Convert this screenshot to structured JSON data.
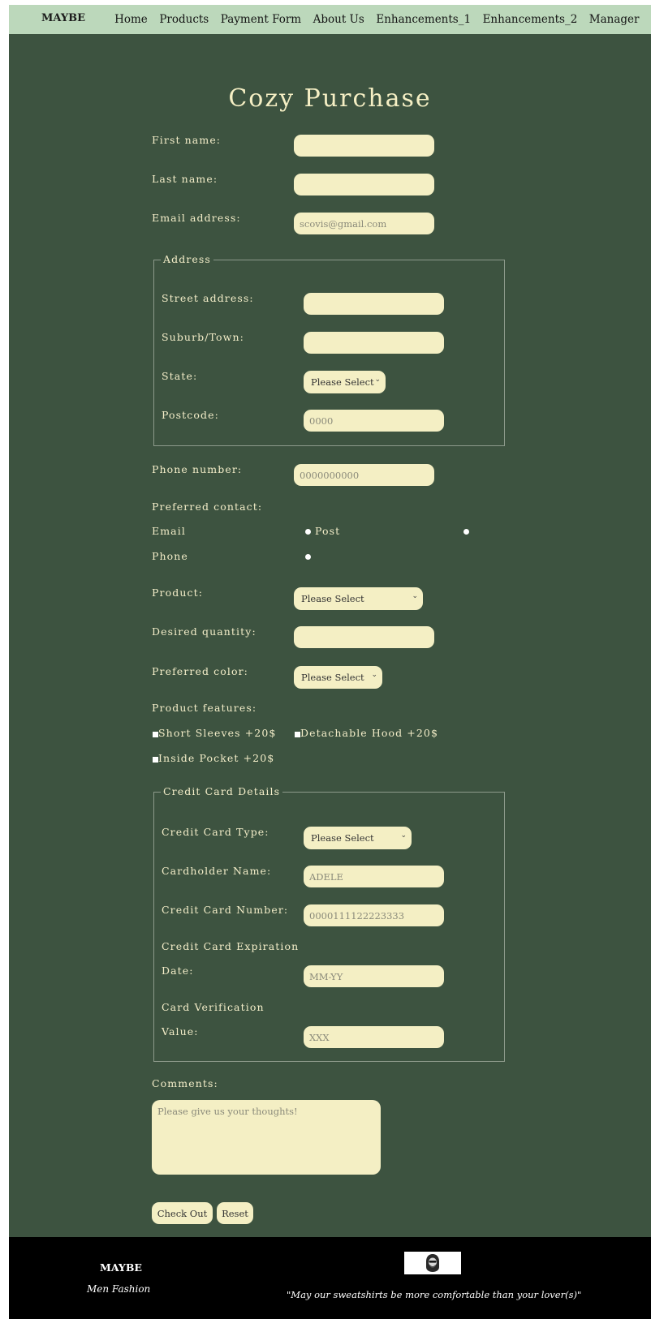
{
  "nav": {
    "brand": "MAYBE",
    "links": [
      "Home",
      "Products",
      "Payment Form",
      "About Us",
      "Enhancements_1",
      "Enhancements_2",
      "Manager"
    ]
  },
  "page_title": "Cozy Purchase",
  "form": {
    "first_name_label": "First name:",
    "last_name_label": "Last name:",
    "email_label": "Email address:",
    "email_placeholder": "scovis@gmail.com",
    "address": {
      "legend": "Address",
      "street_label": "Street address:",
      "suburb_label": "Suburb/Town:",
      "state_label": "State:",
      "state_value": "Please Select",
      "postcode_label": "Postcode:",
      "postcode_placeholder": "0000"
    },
    "phone_label": "Phone number:",
    "phone_placeholder": "0000000000",
    "preferred_contact_label": "Preferred contact:",
    "contact_email": "Email",
    "contact_post": "Post",
    "contact_phone": "Phone",
    "product_label": "Product:",
    "product_value": "Please Select",
    "quantity_label": "Desired quantity:",
    "color_label": "Preferred color:",
    "color_value": "Please Select",
    "features_label": "Product features:",
    "feature_short_sleeves": "Short Sleeves +20$",
    "feature_detachable_hood": "Detachable Hood +20$",
    "feature_inside_pocket": "Inside Pocket +20$",
    "credit": {
      "legend": "Credit Card Details",
      "type_label": "Credit Card Type:",
      "type_value": "Please Select",
      "holder_label": "Cardholder Name:",
      "holder_placeholder": "ADELE",
      "number_label": "Credit Card Number:",
      "number_placeholder": "0000111122223333",
      "expiry_label_1": "Credit Card Expiration",
      "expiry_label_2": "Date:",
      "expiry_placeholder": "MM-YY",
      "cvv_label_1": "Card Verification",
      "cvv_label_2": "Value:",
      "cvv_placeholder": "XXX"
    },
    "comments_label": "Comments:",
    "comments_placeholder": "Please give us your thoughts!",
    "checkout_label": "Check Out",
    "reset_label": "Reset"
  },
  "footer": {
    "brand": "MAYBE",
    "tagline": "Men Fashion",
    "quote": "\"May our sweatshirts be more comfortable than your lover(s)\"",
    "logo_icon": "hooded-figure-logo-icon"
  }
}
